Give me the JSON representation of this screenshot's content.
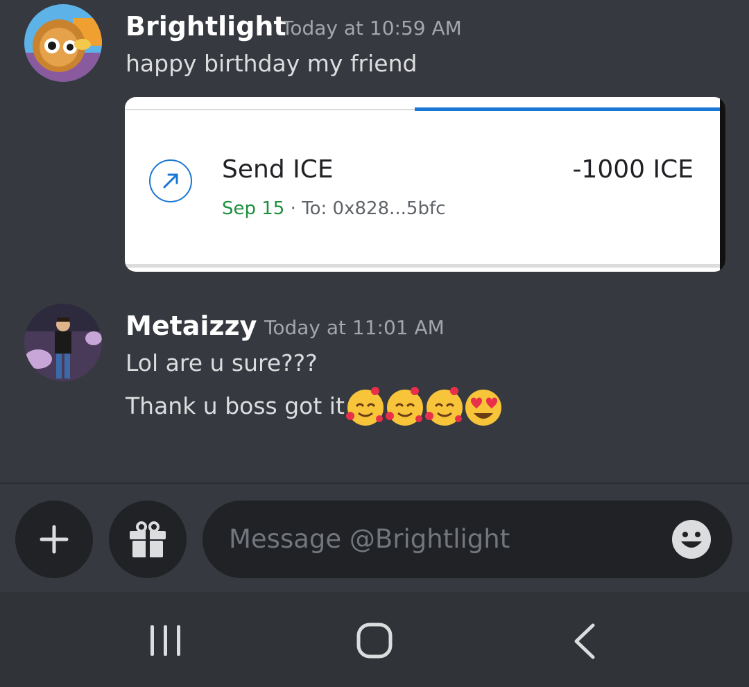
{
  "messages": [
    {
      "username": "Brightlight",
      "timestamp": "Today at 10:59 AM",
      "lines": [
        "happy birthday my friend"
      ]
    },
    {
      "username": "Metaizzy",
      "timestamp": "Today at 11:01 AM",
      "lines": [
        "Lol are u sure???",
        "Thank u boss got it"
      ]
    }
  ],
  "transaction_card": {
    "title": "Send ICE",
    "amount": "-1000 ICE",
    "date": "Sep 15",
    "separator": " · ",
    "recipient": "To: 0x828...5bfc",
    "icon": "arrow-up-right-icon"
  },
  "reactions_inline": [
    "smiling-face-with-hearts",
    "smiling-face-with-hearts",
    "smiling-face-with-hearts",
    "heart-eyes"
  ],
  "composer": {
    "placeholder": "Message @Brightlight",
    "buttons": [
      "plus-icon",
      "gift-icon",
      "emoji-icon"
    ]
  },
  "navbar": [
    "recent-apps-icon",
    "home-icon",
    "back-icon"
  ],
  "colors": {
    "background": "#36393f",
    "input_bg": "#202225",
    "accent_blue": "#1976d2",
    "date_green": "#1e8e3e"
  }
}
